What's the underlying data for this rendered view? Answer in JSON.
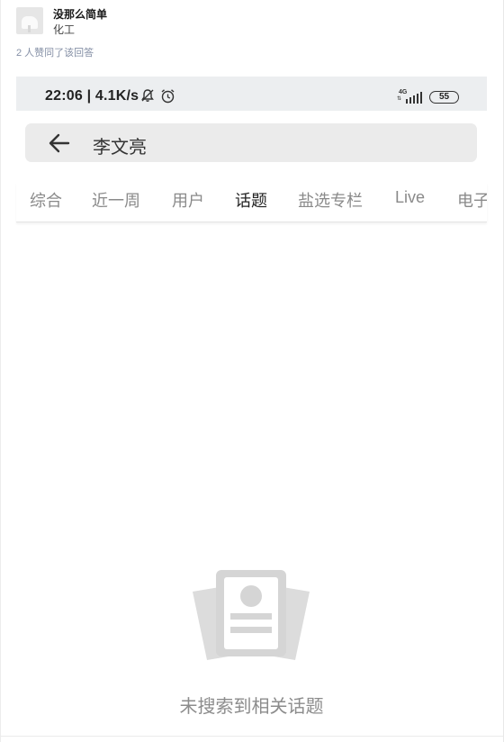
{
  "author": {
    "name": "没那么简单",
    "headline": "化工"
  },
  "votes_text": "2 人赞同了该回答",
  "phone": {
    "status": {
      "time": "22:06 | 4.1K/s",
      "network": "4G",
      "battery": "55"
    },
    "search": {
      "query": "李文亮"
    },
    "tabs": [
      "综合",
      "近一周",
      "用户",
      "话题",
      "盐选专栏",
      "Live",
      "电子"
    ],
    "active_tab": "话题",
    "empty_message": "未搜索到相关话题"
  }
}
